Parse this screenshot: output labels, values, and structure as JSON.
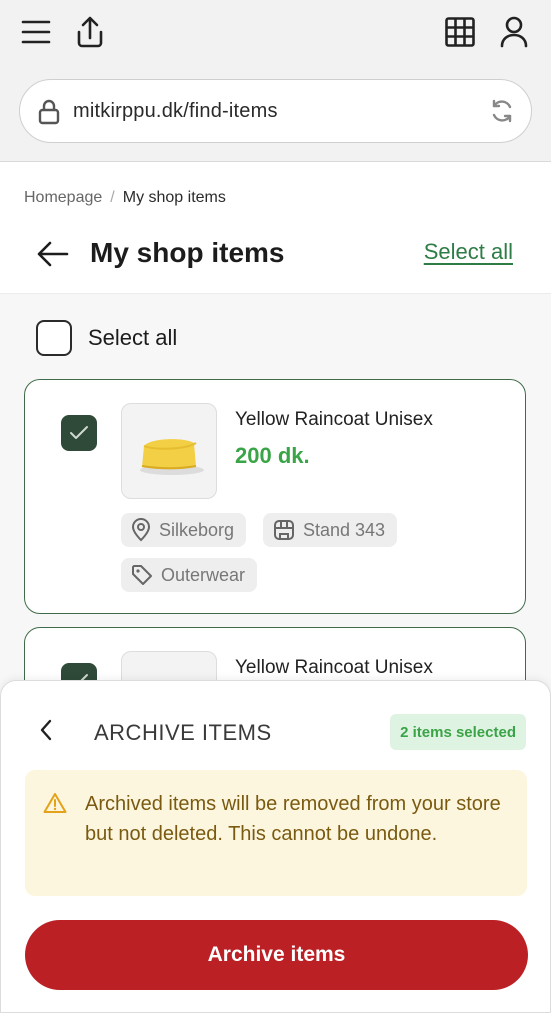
{
  "browser": {
    "url": "mitkirppu.dk/find-items"
  },
  "breadcrumb": {
    "home": "Homepage",
    "separator": "/",
    "current": "My shop items"
  },
  "header": {
    "title": "My shop items",
    "select_all_link": "Select all"
  },
  "list": {
    "select_all_label": "Select all",
    "items": [
      {
        "name": "Yellow Raincoat Unisex",
        "price": "200 dk.",
        "location": "Silkeborg",
        "stand": "Stand 343",
        "category": "Outerwear",
        "selected": true
      },
      {
        "name": "Yellow Raincoat Unisex",
        "selected": true
      }
    ]
  },
  "sheet": {
    "title": "ARCHIVE ITEMS",
    "badge": "2 items selected",
    "warning": "Archived items will be removed from your store but not deleted. This cannot be undone.",
    "action_label": "Archive items"
  },
  "colors": {
    "accent_green": "#3aa447",
    "link_green": "#2e7d46",
    "danger": "#bb2025",
    "warning_bg": "#fdf6df"
  },
  "icons": [
    "menu-icon",
    "share-icon",
    "grid-icon",
    "user-icon",
    "lock-icon",
    "reload-icon",
    "back-arrow-icon",
    "check-icon",
    "location-pin-icon",
    "stand-icon",
    "tag-icon",
    "chevron-left-icon",
    "warning-icon"
  ]
}
